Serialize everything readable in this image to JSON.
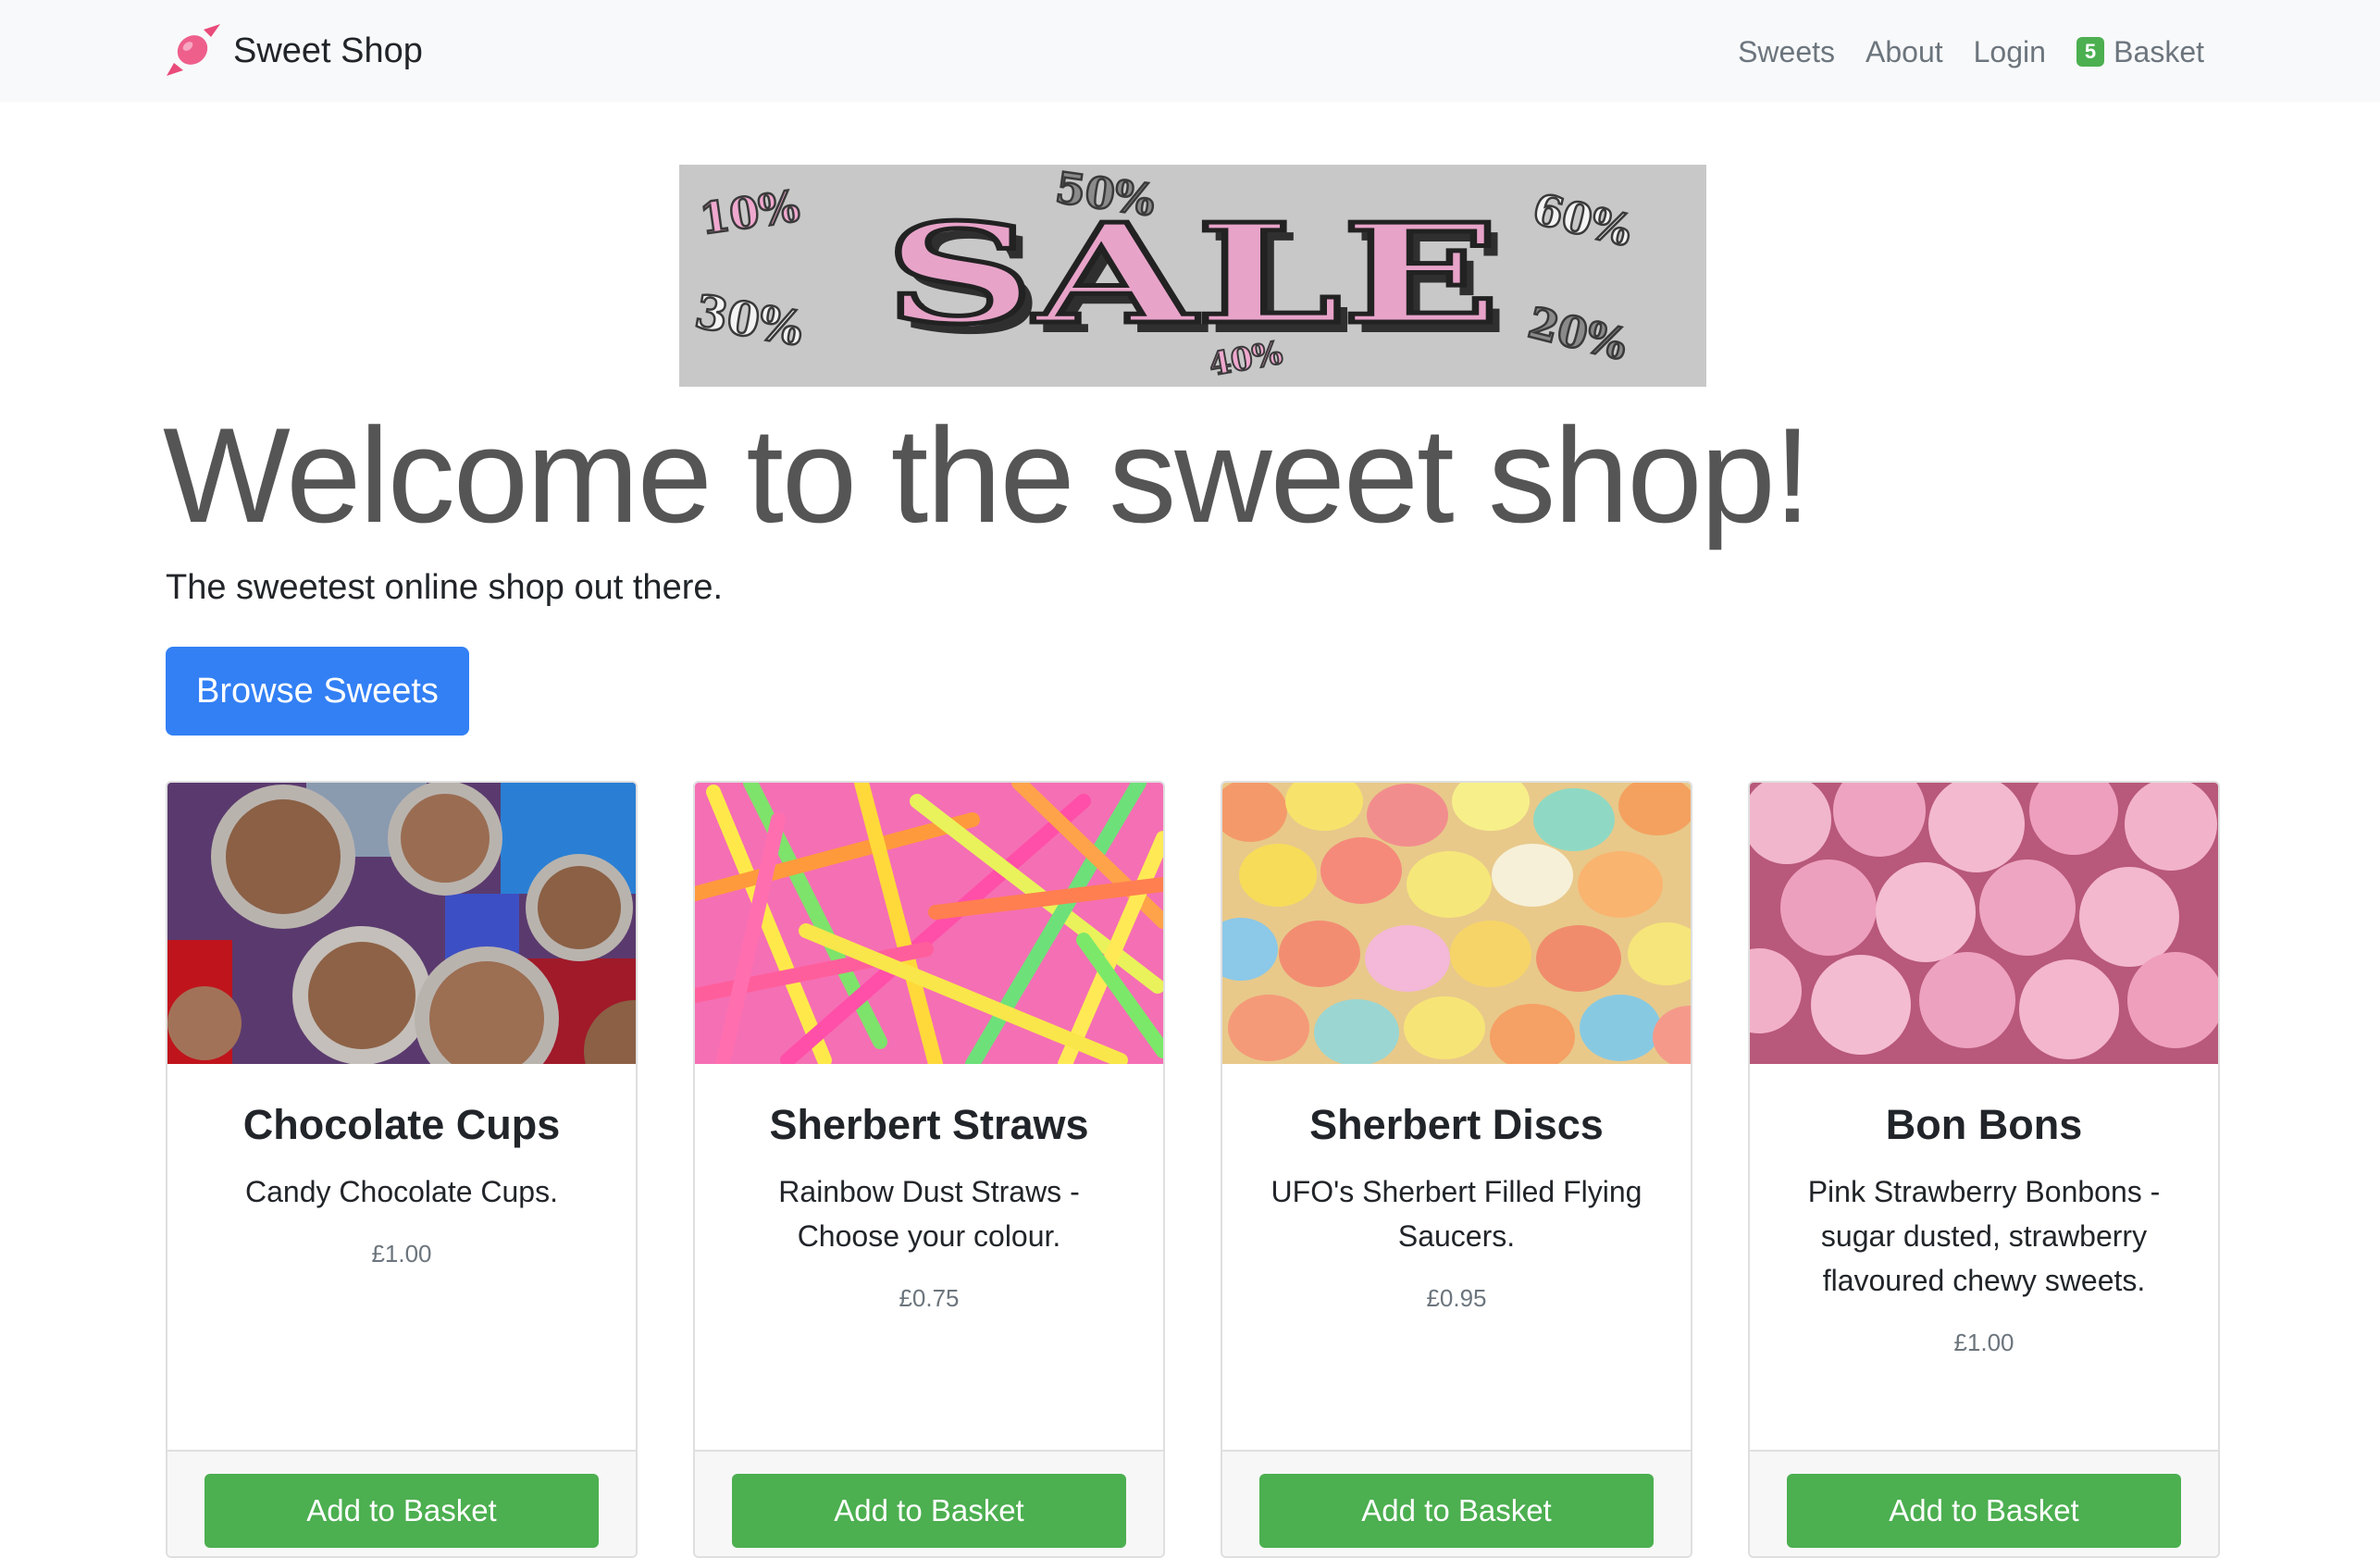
{
  "navbar": {
    "brand_name": "Sweet Shop",
    "links": [
      "Sweets",
      "About",
      "Login"
    ],
    "basket_count": "5",
    "basket_label": "Basket"
  },
  "banner": {
    "main_text": "SALE",
    "percentages": [
      "10%",
      "50%",
      "60%",
      "30%",
      "40%",
      "20%"
    ]
  },
  "hero": {
    "title": "Welcome to the sweet shop!",
    "subtitle": "The sweetest online shop out there.",
    "button_label": "Browse Sweets"
  },
  "products": [
    {
      "title": "Chocolate Cups",
      "description": "Candy Chocolate Cups.",
      "price": "£1.00",
      "button": "Add to Basket"
    },
    {
      "title": "Sherbert Straws",
      "description": "Rainbow Dust Straws - Choose your colour.",
      "price": "£0.75",
      "button": "Add to Basket"
    },
    {
      "title": "Sherbert Discs",
      "description": "UFO's Sherbert Filled Flying Saucers.",
      "price": "£0.95",
      "button": "Add to Basket"
    },
    {
      "title": "Bon Bons",
      "description": "Pink Strawberry Bonbons - sugar dusted, strawberry flavoured chewy sweets.",
      "price": "£1.00",
      "button": "Add to Basket"
    }
  ],
  "colors": {
    "primary": "#3380f5",
    "success": "#4caf50",
    "navbar_bg": "#f8f9fa",
    "sale_pink": "#e8a3c9"
  }
}
